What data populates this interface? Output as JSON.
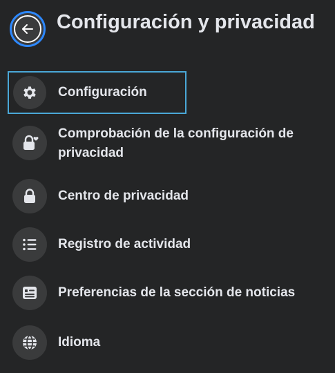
{
  "header": {
    "back_icon": "arrow-left-icon",
    "title": "Configuración y privacidad"
  },
  "menu": {
    "items": [
      {
        "label": "Configuración",
        "icon": "gear-icon",
        "focused": true
      },
      {
        "label": "Comprobación de la configuración de privacidad",
        "icon": "lock-heart-icon",
        "focused": false
      },
      {
        "label": "Centro de privacidad",
        "icon": "lock-icon",
        "focused": false
      },
      {
        "label": "Registro de actividad",
        "icon": "list-icon",
        "focused": false
      },
      {
        "label": "Preferencias de la sección de noticias",
        "icon": "news-feed-icon",
        "focused": false
      },
      {
        "label": "Idioma",
        "icon": "globe-icon",
        "focused": false
      }
    ]
  },
  "colors": {
    "background": "#242526",
    "icon_circle": "#3a3b3c",
    "text": "#e4e6eb",
    "focus": "#4aa8d8",
    "back_ring": "#2d88ff"
  }
}
